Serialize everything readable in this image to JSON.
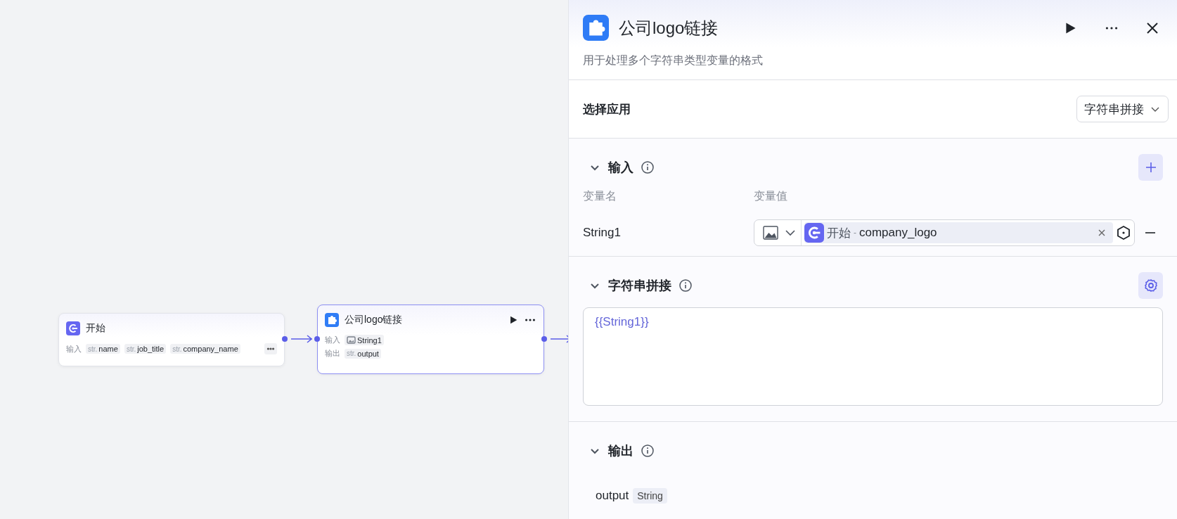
{
  "canvas": {
    "nodes": [
      {
        "kind": "start",
        "title": "开始",
        "selected": false,
        "overflow": true,
        "rows": [
          {
            "label": "输入",
            "params": [
              {
                "kind": "str",
                "type_label": "str.",
                "name": "name"
              },
              {
                "kind": "str",
                "type_label": "str.",
                "name": "job_title"
              },
              {
                "kind": "str",
                "type_label": "str.",
                "name": "company_name"
              }
            ]
          }
        ]
      },
      {
        "kind": "tool",
        "title": "公司logo链接",
        "selected": true,
        "overflow": false,
        "rows": [
          {
            "label": "输入",
            "params": [
              {
                "kind": "image",
                "name": "String1"
              }
            ]
          },
          {
            "label": "输出",
            "params": [
              {
                "kind": "str",
                "type_label": "str.",
                "name": "output"
              }
            ]
          }
        ]
      }
    ]
  },
  "panel": {
    "title": "公司logo链接",
    "description": "用于处理多个字符串类型变量的格式",
    "app_select": {
      "label": "选择应用",
      "value": "字符串拼接"
    },
    "input": {
      "title": "输入",
      "expanded": true,
      "columns": [
        "变量名",
        "变量值"
      ],
      "rows": [
        {
          "name": "String1",
          "source_node": "开始",
          "separator": "-",
          "source_field": "company_logo"
        }
      ]
    },
    "concat": {
      "title": "字符串拼接",
      "expanded": true,
      "template": "{{String1}}"
    },
    "output": {
      "title": "输出",
      "expanded": true,
      "rows": [
        {
          "name": "output",
          "type": "String"
        }
      ]
    }
  }
}
